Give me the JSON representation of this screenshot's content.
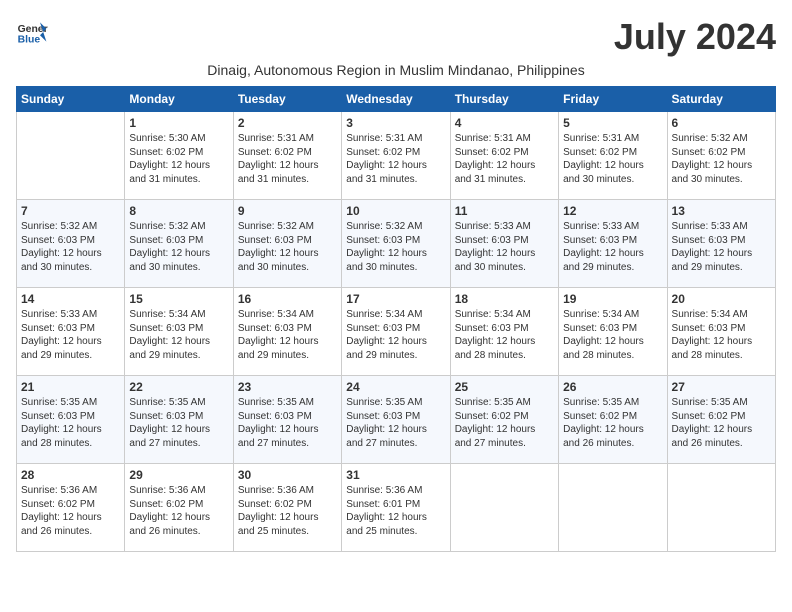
{
  "header": {
    "logo_line1": "General",
    "logo_line2": "Blue",
    "month_title": "July 2024",
    "subtitle": "Dinaig, Autonomous Region in Muslim Mindanao, Philippines"
  },
  "days_of_week": [
    "Sunday",
    "Monday",
    "Tuesday",
    "Wednesday",
    "Thursday",
    "Friday",
    "Saturday"
  ],
  "weeks": [
    [
      {
        "num": "",
        "info": ""
      },
      {
        "num": "1",
        "info": "Sunrise: 5:30 AM\nSunset: 6:02 PM\nDaylight: 12 hours\nand 31 minutes."
      },
      {
        "num": "2",
        "info": "Sunrise: 5:31 AM\nSunset: 6:02 PM\nDaylight: 12 hours\nand 31 minutes."
      },
      {
        "num": "3",
        "info": "Sunrise: 5:31 AM\nSunset: 6:02 PM\nDaylight: 12 hours\nand 31 minutes."
      },
      {
        "num": "4",
        "info": "Sunrise: 5:31 AM\nSunset: 6:02 PM\nDaylight: 12 hours\nand 31 minutes."
      },
      {
        "num": "5",
        "info": "Sunrise: 5:31 AM\nSunset: 6:02 PM\nDaylight: 12 hours\nand 30 minutes."
      },
      {
        "num": "6",
        "info": "Sunrise: 5:32 AM\nSunset: 6:02 PM\nDaylight: 12 hours\nand 30 minutes."
      }
    ],
    [
      {
        "num": "7",
        "info": "Sunrise: 5:32 AM\nSunset: 6:03 PM\nDaylight: 12 hours\nand 30 minutes."
      },
      {
        "num": "8",
        "info": "Sunrise: 5:32 AM\nSunset: 6:03 PM\nDaylight: 12 hours\nand 30 minutes."
      },
      {
        "num": "9",
        "info": "Sunrise: 5:32 AM\nSunset: 6:03 PM\nDaylight: 12 hours\nand 30 minutes."
      },
      {
        "num": "10",
        "info": "Sunrise: 5:32 AM\nSunset: 6:03 PM\nDaylight: 12 hours\nand 30 minutes."
      },
      {
        "num": "11",
        "info": "Sunrise: 5:33 AM\nSunset: 6:03 PM\nDaylight: 12 hours\nand 30 minutes."
      },
      {
        "num": "12",
        "info": "Sunrise: 5:33 AM\nSunset: 6:03 PM\nDaylight: 12 hours\nand 29 minutes."
      },
      {
        "num": "13",
        "info": "Sunrise: 5:33 AM\nSunset: 6:03 PM\nDaylight: 12 hours\nand 29 minutes."
      }
    ],
    [
      {
        "num": "14",
        "info": "Sunrise: 5:33 AM\nSunset: 6:03 PM\nDaylight: 12 hours\nand 29 minutes."
      },
      {
        "num": "15",
        "info": "Sunrise: 5:34 AM\nSunset: 6:03 PM\nDaylight: 12 hours\nand 29 minutes."
      },
      {
        "num": "16",
        "info": "Sunrise: 5:34 AM\nSunset: 6:03 PM\nDaylight: 12 hours\nand 29 minutes."
      },
      {
        "num": "17",
        "info": "Sunrise: 5:34 AM\nSunset: 6:03 PM\nDaylight: 12 hours\nand 29 minutes."
      },
      {
        "num": "18",
        "info": "Sunrise: 5:34 AM\nSunset: 6:03 PM\nDaylight: 12 hours\nand 28 minutes."
      },
      {
        "num": "19",
        "info": "Sunrise: 5:34 AM\nSunset: 6:03 PM\nDaylight: 12 hours\nand 28 minutes."
      },
      {
        "num": "20",
        "info": "Sunrise: 5:34 AM\nSunset: 6:03 PM\nDaylight: 12 hours\nand 28 minutes."
      }
    ],
    [
      {
        "num": "21",
        "info": "Sunrise: 5:35 AM\nSunset: 6:03 PM\nDaylight: 12 hours\nand 28 minutes."
      },
      {
        "num": "22",
        "info": "Sunrise: 5:35 AM\nSunset: 6:03 PM\nDaylight: 12 hours\nand 27 minutes."
      },
      {
        "num": "23",
        "info": "Sunrise: 5:35 AM\nSunset: 6:03 PM\nDaylight: 12 hours\nand 27 minutes."
      },
      {
        "num": "24",
        "info": "Sunrise: 5:35 AM\nSunset: 6:03 PM\nDaylight: 12 hours\nand 27 minutes."
      },
      {
        "num": "25",
        "info": "Sunrise: 5:35 AM\nSunset: 6:02 PM\nDaylight: 12 hours\nand 27 minutes."
      },
      {
        "num": "26",
        "info": "Sunrise: 5:35 AM\nSunset: 6:02 PM\nDaylight: 12 hours\nand 26 minutes."
      },
      {
        "num": "27",
        "info": "Sunrise: 5:35 AM\nSunset: 6:02 PM\nDaylight: 12 hours\nand 26 minutes."
      }
    ],
    [
      {
        "num": "28",
        "info": "Sunrise: 5:36 AM\nSunset: 6:02 PM\nDaylight: 12 hours\nand 26 minutes."
      },
      {
        "num": "29",
        "info": "Sunrise: 5:36 AM\nSunset: 6:02 PM\nDaylight: 12 hours\nand 26 minutes."
      },
      {
        "num": "30",
        "info": "Sunrise: 5:36 AM\nSunset: 6:02 PM\nDaylight: 12 hours\nand 25 minutes."
      },
      {
        "num": "31",
        "info": "Sunrise: 5:36 AM\nSunset: 6:01 PM\nDaylight: 12 hours\nand 25 minutes."
      },
      {
        "num": "",
        "info": ""
      },
      {
        "num": "",
        "info": ""
      },
      {
        "num": "",
        "info": ""
      }
    ]
  ]
}
